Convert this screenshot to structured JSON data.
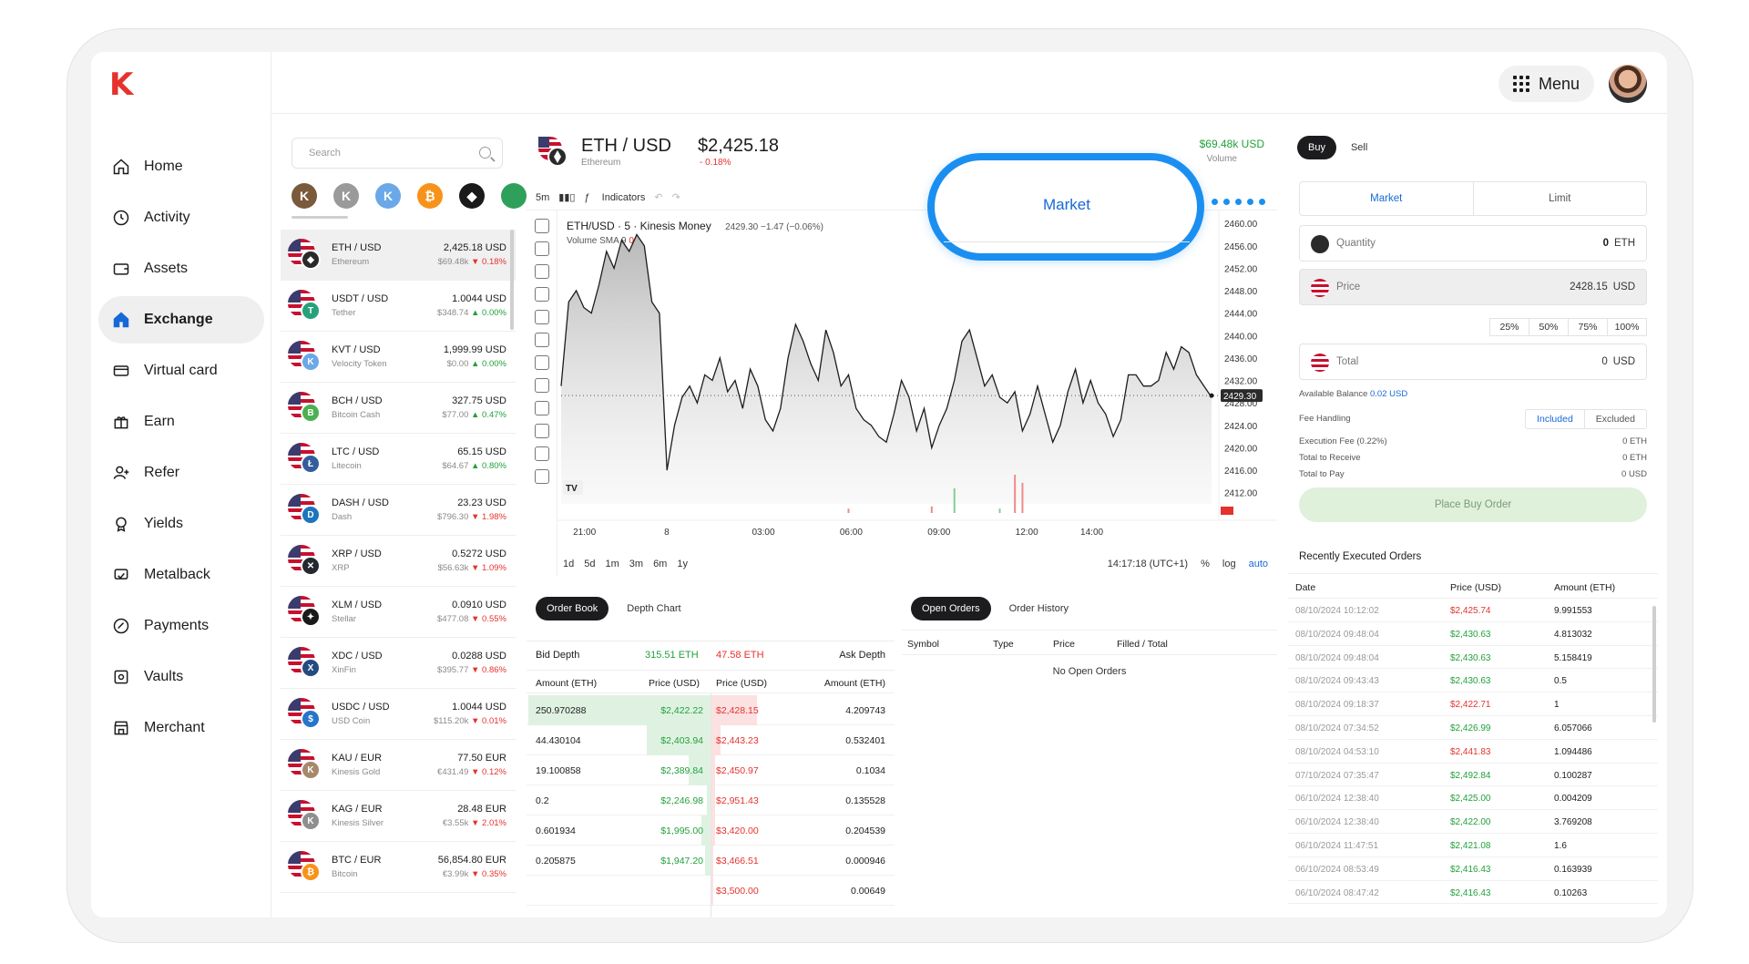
{
  "brand": {
    "logo": "K",
    "accent": "#1769d6",
    "alert": "#e5322d"
  },
  "nav": [
    {
      "label": "Home",
      "icon": "home-icon"
    },
    {
      "label": "Activity",
      "icon": "clock-icon"
    },
    {
      "label": "Assets",
      "icon": "wallet-icon"
    },
    {
      "label": "Exchange",
      "icon": "exchange-icon",
      "active": true
    },
    {
      "label": "Virtual card",
      "icon": "card-icon"
    },
    {
      "label": "Earn",
      "icon": "gift-icon"
    },
    {
      "label": "Refer",
      "icon": "refer-icon"
    },
    {
      "label": "Yields",
      "icon": "badge-icon"
    },
    {
      "label": "Metalback",
      "icon": "metalback-icon"
    },
    {
      "label": "Payments",
      "icon": "payments-icon"
    },
    {
      "label": "Vaults",
      "icon": "vault-icon"
    },
    {
      "label": "Merchant",
      "icon": "store-icon"
    }
  ],
  "topbar": {
    "menu_label": "Menu"
  },
  "pairs": {
    "search_placeholder": "Search",
    "items": [
      {
        "name": "ETH / USD",
        "desc": "Ethereum",
        "price": "2,425.18 USD",
        "vol": "$69.48k",
        "chg": "▼ 0.18%",
        "dir": "neg",
        "coin": "#2a2a2a",
        "sym": "◆"
      },
      {
        "name": "USDT / USD",
        "desc": "Tether",
        "price": "1.0044 USD",
        "vol": "$348.74",
        "chg": "▲ 0.00%",
        "dir": "pos",
        "coin": "#26a17b",
        "sym": "T"
      },
      {
        "name": "KVT / USD",
        "desc": "Velocity Token",
        "price": "1,999.99 USD",
        "vol": "$0.00",
        "chg": "▲ 0.00%",
        "dir": "pos",
        "coin": "#6aa8e8",
        "sym": "K"
      },
      {
        "name": "BCH / USD",
        "desc": "Bitcoin Cash",
        "price": "327.75 USD",
        "vol": "$77.00",
        "chg": "▲ 0.47%",
        "dir": "pos",
        "coin": "#4cb050",
        "sym": "B"
      },
      {
        "name": "LTC / USD",
        "desc": "Litecoin",
        "price": "65.15 USD",
        "vol": "$64.67",
        "chg": "▲ 0.80%",
        "dir": "pos",
        "coin": "#345d9d",
        "sym": "Ł"
      },
      {
        "name": "DASH / USD",
        "desc": "Dash",
        "price": "23.23 USD",
        "vol": "$796.30",
        "chg": "▼ 1.98%",
        "dir": "neg",
        "coin": "#1c75bc",
        "sym": "D"
      },
      {
        "name": "XRP / USD",
        "desc": "XRP",
        "price": "0.5272 USD",
        "vol": "$56.63k",
        "chg": "▼ 1.09%",
        "dir": "neg",
        "coin": "#23292f",
        "sym": "✕"
      },
      {
        "name": "XLM / USD",
        "desc": "Stellar",
        "price": "0.0910 USD",
        "vol": "$477.08",
        "chg": "▼ 0.55%",
        "dir": "neg",
        "coin": "#1a1a1a",
        "sym": "✦"
      },
      {
        "name": "XDC / USD",
        "desc": "XinFin",
        "price": "0.0288 USD",
        "vol": "$395.77",
        "chg": "▼ 0.86%",
        "dir": "neg",
        "coin": "#244b81",
        "sym": "X"
      },
      {
        "name": "USDC / USD",
        "desc": "USD Coin",
        "price": "1.0044 USD",
        "vol": "$115.20k",
        "chg": "▼ 0.01%",
        "dir": "neg",
        "coin": "#2775ca",
        "sym": "$"
      },
      {
        "name": "KAU / EUR",
        "desc": "Kinesis Gold",
        "price": "77.50 EUR",
        "vol": "€431.49",
        "chg": "▼ 0.12%",
        "dir": "neg",
        "coin": "#a5896a",
        "sym": "K"
      },
      {
        "name": "KAG / EUR",
        "desc": "Kinesis Silver",
        "price": "28.48 EUR",
        "vol": "€3.55k",
        "chg": "▼ 2.01%",
        "dir": "neg",
        "coin": "#8f8f8f",
        "sym": "K"
      },
      {
        "name": "BTC / EUR",
        "desc": "Bitcoin",
        "price": "56,854.80 EUR",
        "vol": "€3.99k",
        "chg": "▼ 0.35%",
        "dir": "neg",
        "coin": "#f7931a",
        "sym": "₿"
      }
    ]
  },
  "quick_coins": [
    {
      "color": "#7a5a3a",
      "sym": "K"
    },
    {
      "color": "#9a9a9a",
      "sym": "K"
    },
    {
      "color": "#6aa8e8",
      "sym": "K"
    },
    {
      "color": "#f7931a",
      "sym": "₿"
    },
    {
      "color": "#1a1a1a",
      "sym": "◆"
    },
    {
      "color": "#2fa05a",
      "sym": ""
    }
  ],
  "header": {
    "pair": "ETH / USD",
    "asset": "Ethereum",
    "price": "$2,425.18",
    "change": "- 0.18%",
    "volume": "$69.48k USD",
    "volume_label": "Volume"
  },
  "chart_toolbar": {
    "interval": "5m",
    "indicators": "Indicators"
  },
  "chart_legend": {
    "title": "ETH/USD · 5 · Kinesis Money",
    "values": "2429.30 −1.47 (−0.06%)",
    "volume": "Volume SMA 9",
    "volume_val": "0"
  },
  "chart_data": {
    "type": "area",
    "title": "ETH/USD · 5 · Kinesis Money",
    "x_ticks": [
      "21:00",
      "8",
      "03:00",
      "06:00",
      "09:00",
      "12:00",
      "14:00"
    ],
    "y_ticks": [
      "2460.00",
      "2456.00",
      "2452.00",
      "2448.00",
      "2444.00",
      "2440.00",
      "2436.00",
      "2432.00",
      "2428.00",
      "2424.00",
      "2420.00",
      "2416.00",
      "2412.00"
    ],
    "ylim": [
      2410,
      2461
    ],
    "last_price": "2429.30",
    "values": [
      2431,
      2446,
      2448,
      2445,
      2444,
      2449,
      2455,
      2452,
      2457,
      2455,
      2458,
      2456,
      2446,
      2444,
      2416,
      2424,
      2429,
      2431,
      2428,
      2433,
      2432,
      2436,
      2430,
      2432,
      2427,
      2434,
      2431,
      2425,
      2423,
      2427,
      2436,
      2442,
      2439,
      2435,
      2432,
      2441,
      2437,
      2431,
      2433,
      2427,
      2425,
      2424,
      2422,
      2421,
      2426,
      2432,
      2429,
      2423,
      2427,
      2420,
      2424,
      2427,
      2432,
      2439,
      2441,
      2436,
      2431,
      2433,
      2429,
      2428,
      2430,
      2423,
      2426,
      2431,
      2426,
      2421,
      2424,
      2430,
      2434,
      2428,
      2432,
      2428,
      2426,
      2422,
      2425,
      2433,
      2433,
      2431,
      2431,
      2432,
      2437,
      2434,
      2438,
      2437,
      2433,
      2431,
      2429
    ],
    "volume_spikes": [
      {
        "index": 52,
        "height": 0.45,
        "dir": "pos"
      },
      {
        "index": 58,
        "height": 0.08,
        "dir": "pos"
      },
      {
        "index": 60,
        "height": 0.7,
        "dir": "neg"
      },
      {
        "index": 61,
        "height": 0.55,
        "dir": "neg"
      },
      {
        "index": 49,
        "height": 0.12,
        "dir": "neg"
      },
      {
        "index": 38,
        "height": 0.08,
        "dir": "neg"
      }
    ]
  },
  "chart_footer": {
    "ranges": [
      "1d",
      "5d",
      "1m",
      "3m",
      "6m",
      "1y"
    ],
    "clock": "14:17:18 (UTC+1)",
    "pct": "%",
    "log": "log",
    "auto": "auto"
  },
  "orderbook": {
    "tabs": [
      "Order Book",
      "Depth Chart"
    ],
    "bid_depth_label": "Bid Depth",
    "bid_depth": "315.51 ETH",
    "ask_depth": "47.58 ETH",
    "ask_depth_label": "Ask Depth",
    "cols": [
      "Amount (ETH)",
      "Price (USD)",
      "Price (USD)",
      "Amount (ETH)"
    ],
    "rows": [
      {
        "bid_amt": "250.970288",
        "bid_px": "$2,422.22",
        "bid_fill": 1.0,
        "ask_px": "$2,428.15",
        "ask_amt": "4.209743",
        "ask_fill": 0.25
      },
      {
        "bid_amt": "44.430104",
        "bid_px": "$2,403.94",
        "bid_fill": 0.35,
        "ask_px": "$2,443.23",
        "ask_amt": "0.532401",
        "ask_fill": 0.05
      },
      {
        "bid_amt": "19.100858",
        "bid_px": "$2,389.84",
        "bid_fill": 0.12,
        "ask_px": "$2,450.97",
        "ask_amt": "0.1034",
        "ask_fill": 0.02
      },
      {
        "bid_amt": "0.2",
        "bid_px": "$2,246.98",
        "bid_fill": 0.02,
        "ask_px": "$2,951.43",
        "ask_amt": "0.135528",
        "ask_fill": 0.02
      },
      {
        "bid_amt": "0.601934",
        "bid_px": "$1,995.00",
        "bid_fill": 0.05,
        "ask_px": "$3,420.00",
        "ask_amt": "0.204539",
        "ask_fill": 0.02
      },
      {
        "bid_amt": "0.205875",
        "bid_px": "$1,947.20",
        "bid_fill": 0.03,
        "ask_px": "$3,466.51",
        "ask_amt": "0.000946",
        "ask_fill": 0.01
      },
      {
        "bid_amt": "",
        "bid_px": "",
        "bid_fill": 0,
        "ask_px": "$3,500.00",
        "ask_amt": "0.00649",
        "ask_fill": 0.01
      }
    ]
  },
  "open_orders": {
    "tabs": [
      "Open Orders",
      "Order History"
    ],
    "cols": [
      "Symbol",
      "Type",
      "Price",
      "Filled / Total"
    ],
    "empty": "No Open Orders"
  },
  "trade": {
    "tabs": [
      "Buy",
      "Sell"
    ],
    "order_types": [
      "Market",
      "Limit"
    ],
    "quantity_label": "Quantity",
    "quantity_value": "0",
    "quantity_unit": "ETH",
    "price_label": "Price",
    "price_value": "2428.15",
    "price_unit": "USD",
    "percents": [
      "25%",
      "50%",
      "75%",
      "100%"
    ],
    "total_label": "Total",
    "total_value": "0",
    "total_unit": "USD",
    "available_label": "Available Balance",
    "available_value": "0.02 USD",
    "fee_label": "Fee Handling",
    "fee_options": [
      "Included",
      "Excluded"
    ],
    "exec_fee_label": "Execution Fee (0.22%)",
    "exec_fee_value": "0 ETH",
    "receive_label": "Total to Receive",
    "receive_value": "0 ETH",
    "pay_label": "Total to Pay",
    "pay_value": "0 USD",
    "place_label": "Place Buy Order"
  },
  "recent": {
    "title": "Recently Executed Orders",
    "cols": [
      "Date",
      "Price (USD)",
      "Amount (ETH)"
    ],
    "rows": [
      {
        "date": "08/10/2024 10:12:02",
        "price": "$2,425.74",
        "amount": "9.991553",
        "dir": "neg"
      },
      {
        "date": "08/10/2024 09:48:04",
        "price": "$2,430.63",
        "amount": "4.813032",
        "dir": "pos"
      },
      {
        "date": "08/10/2024 09:48:04",
        "price": "$2,430.63",
        "amount": "5.158419",
        "dir": "pos"
      },
      {
        "date": "08/10/2024 09:43:43",
        "price": "$2,430.63",
        "amount": "0.5",
        "dir": "pos"
      },
      {
        "date": "08/10/2024 09:18:37",
        "price": "$2,422.71",
        "amount": "1",
        "dir": "neg"
      },
      {
        "date": "08/10/2024 07:34:52",
        "price": "$2,426.99",
        "amount": "6.057066",
        "dir": "pos"
      },
      {
        "date": "08/10/2024 04:53:10",
        "price": "$2,441.83",
        "amount": "1.094486",
        "dir": "neg"
      },
      {
        "date": "07/10/2024 07:35:47",
        "price": "$2,492.84",
        "amount": "0.100287",
        "dir": "pos"
      },
      {
        "date": "06/10/2024 12:38:40",
        "price": "$2,425.00",
        "amount": "0.004209",
        "dir": "pos"
      },
      {
        "date": "06/10/2024 12:38:40",
        "price": "$2,422.00",
        "amount": "3.769208",
        "dir": "pos"
      },
      {
        "date": "06/10/2024 11:47:51",
        "price": "$2,421.08",
        "amount": "1.6",
        "dir": "pos"
      },
      {
        "date": "06/10/2024 08:53:49",
        "price": "$2,416.43",
        "amount": "0.163939",
        "dir": "pos"
      },
      {
        "date": "06/10/2024 08:47:42",
        "price": "$2,416.43",
        "amount": "0.10263",
        "dir": "pos"
      }
    ]
  },
  "callout": {
    "label": "Market"
  }
}
